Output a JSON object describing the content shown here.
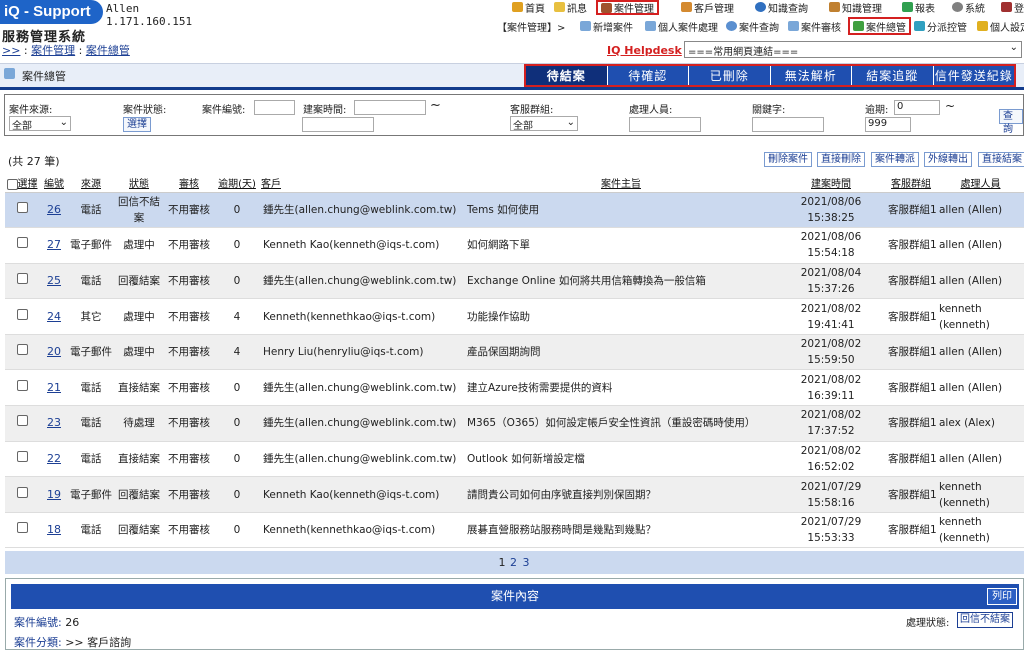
{
  "app": {
    "logo": "iQ - Support",
    "user_name": "Allen",
    "user_ip": "1.171.160.151",
    "system_name": "服務管理系統"
  },
  "breadcrumb": {
    "root": ">>",
    "sep": " : ",
    "level1": "案件管理",
    "level2": "案件總管"
  },
  "top_nav": [
    {
      "label": "首頁",
      "icon": "home-icon",
      "color": "#e0a020"
    },
    {
      "label": "訊息",
      "icon": "mail-icon",
      "color": "#e8c040"
    },
    {
      "label": "案件管理",
      "icon": "folder-icon",
      "color": "#a0522d"
    },
    {
      "label": "客戶管理",
      "icon": "users-icon",
      "color": "#d48a30"
    },
    {
      "label": "知識查詢",
      "icon": "search-icon",
      "color": "#3070c0"
    },
    {
      "label": "知識管理",
      "icon": "book-icon",
      "color": "#c08030"
    },
    {
      "label": "報表",
      "icon": "report-icon",
      "color": "#30a050"
    },
    {
      "label": "系統",
      "icon": "gear-icon",
      "color": "#808080"
    },
    {
      "label": "登出",
      "icon": "logout-icon",
      "color": "#a03030"
    }
  ],
  "sub_nav": {
    "prefix": "【案件管理】>",
    "items": [
      {
        "label": "新增案件",
        "icon": "new-case-icon"
      },
      {
        "label": "個人案件處理",
        "icon": "personal-case-icon"
      },
      {
        "label": "案件查詢",
        "icon": "case-search-icon"
      },
      {
        "label": "案件審核",
        "icon": "case-review-icon"
      },
      {
        "label": "案件總管",
        "icon": "case-master-icon"
      },
      {
        "label": "分派控管",
        "icon": "dispatch-icon"
      },
      {
        "label": "個人設定",
        "icon": "settings-icon"
      }
    ]
  },
  "helpdesk": {
    "label": "IQ Helpdesk",
    "links_select": "===常用網頁連結==="
  },
  "page_title": "案件總管",
  "tabs": [
    "待結案",
    "待確認",
    "已刪除",
    "無法解析",
    "結案追蹤",
    "信件發送紀錄"
  ],
  "filter": {
    "source_label": "案件來源:",
    "source_value": "全部",
    "status_label": "案件狀態:",
    "status_button": "選擇",
    "case_no_label": "案件編號:",
    "created_label": "建案時間:",
    "range_sep": "~",
    "group_label": "客服群組:",
    "group_value": "全部",
    "handler_label": "處理人員:",
    "keyword_label": "關鍵字:",
    "overdue_label": "逾期:",
    "overdue_from": "0",
    "overdue_to": "999",
    "query_button": "查詢"
  },
  "list": {
    "count_text": "(共 27 筆)",
    "actions": [
      "刪除案件",
      "直接刪除",
      "案件轉派",
      "外線轉出",
      "直接結案"
    ],
    "headers": [
      "選擇",
      "編號",
      "來源",
      "狀態",
      "審核",
      "逾期(天)",
      "客戶",
      "案件主旨",
      "建案時間",
      "客服群組",
      "處理人員"
    ],
    "rows": [
      {
        "id": "26",
        "source": "電話",
        "status": "回信不結案",
        "review": "不用審核",
        "overdue": "0",
        "customer": "鍾先生(allen.chung@weblink.com.tw)",
        "subject": "Tems 如何使用",
        "date": "2021/08/06",
        "time": "15:38:25",
        "group": "客服群組1",
        "handler": "allen (Allen)"
      },
      {
        "id": "27",
        "source": "電子郵件",
        "status": "處理中",
        "review": "不用審核",
        "overdue": "0",
        "customer": "Kenneth Kao(kenneth@iqs-t.com)",
        "subject": "如何網路下單",
        "date": "2021/08/06",
        "time": "15:54:18",
        "group": "客服群組1",
        "handler": "allen (Allen)"
      },
      {
        "id": "25",
        "source": "電話",
        "status": "回覆結案",
        "review": "不用審核",
        "overdue": "0",
        "customer": "鍾先生(allen.chung@weblink.com.tw)",
        "subject": "Exchange Online 如何將共用信箱轉換為一般信箱",
        "date": "2021/08/04",
        "time": "15:37:26",
        "group": "客服群組1",
        "handler": "allen (Allen)"
      },
      {
        "id": "24",
        "source": "其它",
        "status": "處理中",
        "review": "不用審核",
        "overdue": "4",
        "customer": "Kenneth(kennethkao@iqs-t.com)",
        "subject": "功能操作協助",
        "date": "2021/08/02",
        "time": "19:41:41",
        "group": "客服群組1",
        "handler": "kenneth (kenneth)"
      },
      {
        "id": "20",
        "source": "電子郵件",
        "status": "處理中",
        "review": "不用審核",
        "overdue": "4",
        "customer": "Henry Liu(henryliu@iqs-t.com)",
        "subject": "產品保固期詢問",
        "date": "2021/08/02",
        "time": "15:59:50",
        "group": "客服群組1",
        "handler": "allen (Allen)"
      },
      {
        "id": "21",
        "source": "電話",
        "status": "直接結案",
        "review": "不用審核",
        "overdue": "0",
        "customer": "鍾先生(allen.chung@weblink.com.tw)",
        "subject": "建立Azure技術需要提供的資料",
        "date": "2021/08/02",
        "time": "16:39:11",
        "group": "客服群組1",
        "handler": "allen (Allen)"
      },
      {
        "id": "23",
        "source": "電話",
        "status": "待處理",
        "review": "不用審核",
        "overdue": "0",
        "customer": "鍾先生(allen.chung@weblink.com.tw)",
        "subject": "M365（O365）如何設定帳戶安全性資訊（重設密碼時使用）",
        "date": "2021/08/02",
        "time": "17:37:52",
        "group": "客服群組1",
        "handler": "alex (Alex)"
      },
      {
        "id": "22",
        "source": "電話",
        "status": "直接結案",
        "review": "不用審核",
        "overdue": "0",
        "customer": "鍾先生(allen.chung@weblink.com.tw)",
        "subject": "Outlook 如何新增設定檔",
        "date": "2021/08/02",
        "time": "16:52:02",
        "group": "客服群組1",
        "handler": "allen (Allen)"
      },
      {
        "id": "19",
        "source": "電子郵件",
        "status": "回覆結案",
        "review": "不用審核",
        "overdue": "0",
        "customer": "Kenneth Kao(kenneth@iqs-t.com)",
        "subject": "請問貴公司如何由序號直接判別保固期？",
        "date": "2021/07/29",
        "time": "15:58:16",
        "group": "客服群組1",
        "handler": "kenneth (kenneth)"
      },
      {
        "id": "18",
        "source": "電話",
        "status": "回覆結案",
        "review": "不用審核",
        "overdue": "0",
        "customer": "Kenneth(kennethkao@iqs-t.com)",
        "subject": "展碁直營服務站服務時間是幾點到幾點？",
        "date": "2021/07/29",
        "time": "15:53:33",
        "group": "客服群組1",
        "handler": "kenneth (kenneth)"
      }
    ]
  },
  "pager": {
    "current": "1",
    "pages": [
      "2",
      "3"
    ]
  },
  "detail": {
    "title": "案件內容",
    "print_button": "列印",
    "case_no_label": "案件編號:",
    "case_no": "26",
    "category_label": "案件分類:",
    "category": ">> 客戶諮詢",
    "status_label": "處理狀態:",
    "status": "回信不結案"
  }
}
